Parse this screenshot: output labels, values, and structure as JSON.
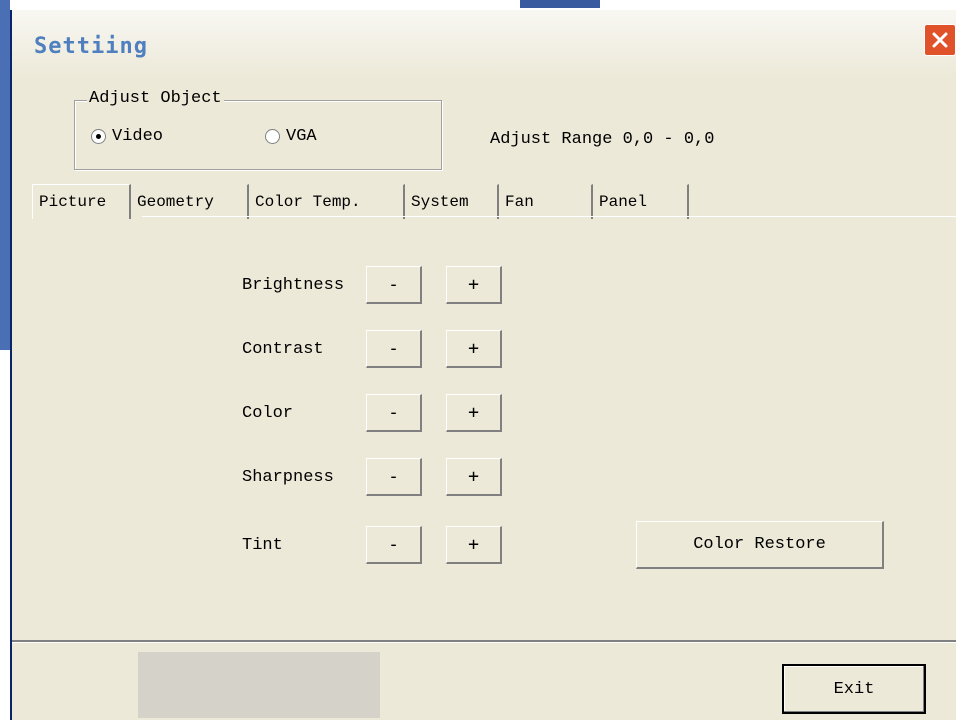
{
  "window": {
    "title": "Settiing"
  },
  "adjust_object": {
    "label": "Adjust Object",
    "options": [
      {
        "label": "Video",
        "checked": true
      },
      {
        "label": "VGA",
        "checked": false
      }
    ]
  },
  "adjust_range": "Adjust Range 0,0 - 0,0",
  "tabs": [
    "Picture",
    "Geometry",
    "Color Temp.",
    "System",
    "Fan",
    "Panel"
  ],
  "active_tab": "Picture",
  "controls": [
    {
      "label": "Brightness",
      "minus": "-",
      "plus": "+"
    },
    {
      "label": "Contrast",
      "minus": "-",
      "plus": "+"
    },
    {
      "label": "Color",
      "minus": "-",
      "plus": "+"
    },
    {
      "label": "Sharpness",
      "minus": "-",
      "plus": "+"
    },
    {
      "label": "Tint",
      "minus": "-",
      "plus": "+"
    }
  ],
  "color_restore_label": "Color Restore",
  "exit_label": "Exit",
  "icons": {
    "close": "close-icon"
  },
  "colors": {
    "title": "#4f7fbf",
    "close": "#e0532a",
    "face": "#ece9d8"
  }
}
